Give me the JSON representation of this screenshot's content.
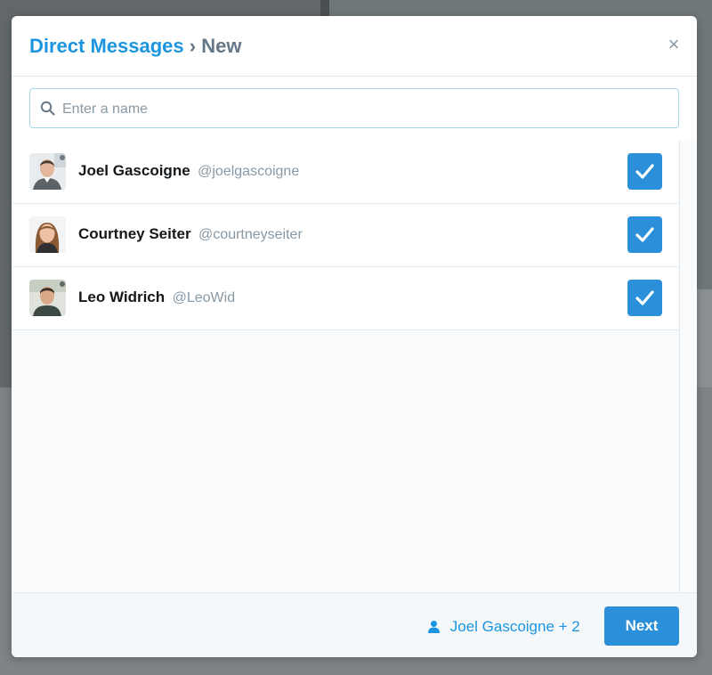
{
  "modal": {
    "title": "Direct Messages",
    "separator": "›",
    "subtitle": "New",
    "close_icon": "close-icon"
  },
  "search": {
    "placeholder": "Enter a name",
    "value": "",
    "icon": "search-icon"
  },
  "users": [
    {
      "name": "Joel Gascoigne",
      "handle": "@joelgascoigne",
      "selected": true
    },
    {
      "name": "Courtney Seiter",
      "handle": "@courtneyseiter",
      "selected": true
    },
    {
      "name": "Leo Widrich",
      "handle": "@LeoWid",
      "selected": true
    }
  ],
  "footer": {
    "selected_summary": "Joel Gascoigne + 2",
    "next_label": "Next"
  },
  "colors": {
    "accent": "#1b95e0",
    "button": "#2b90d9",
    "muted": "#8899a6",
    "border": "#e1e8ed"
  }
}
